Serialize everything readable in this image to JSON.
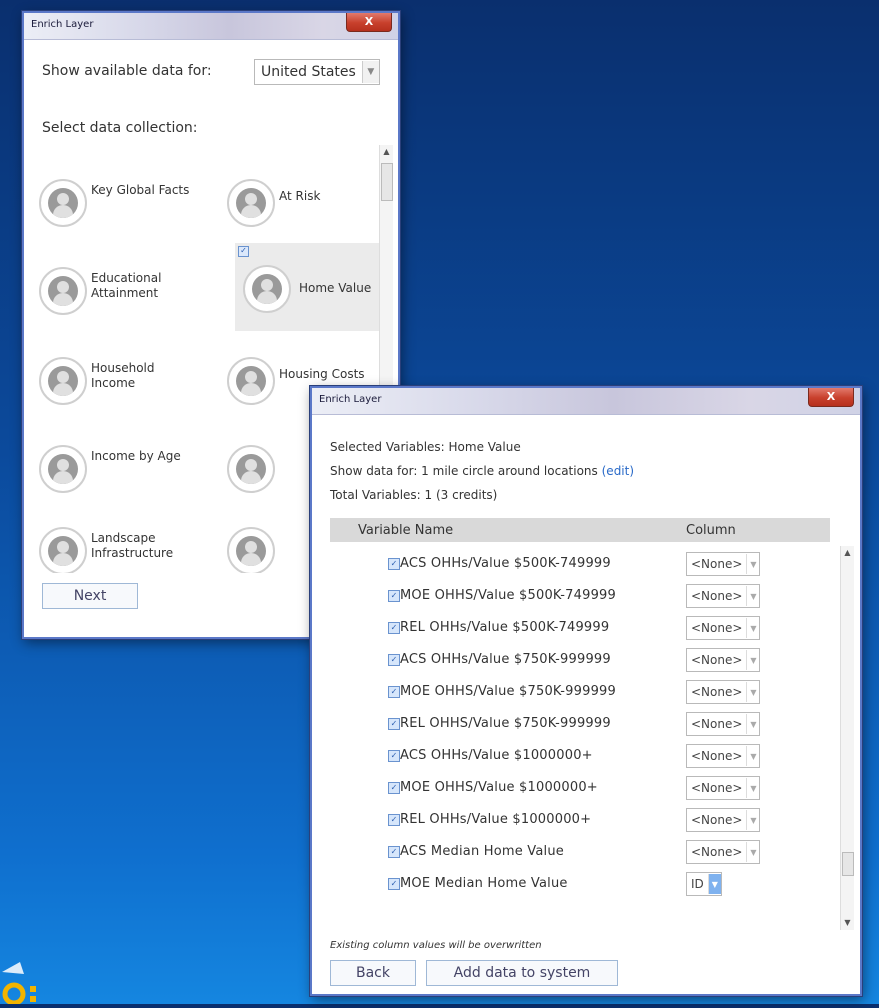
{
  "window1": {
    "title": "Enrich Layer",
    "close_label": "X",
    "show_label": "Show available data for:",
    "country": "United States",
    "select_label": "Select data collection:",
    "collections": [
      {
        "label": "Key Global Facts",
        "selected": false
      },
      {
        "label": "At Risk",
        "selected": false
      },
      {
        "label": "Educational Attainment",
        "selected": false
      },
      {
        "label": "Home Value",
        "selected": true
      },
      {
        "label": "Household Income",
        "selected": false
      },
      {
        "label": "Housing Costs",
        "selected": false
      },
      {
        "label": "Income by Age",
        "selected": false
      },
      {
        "label": "",
        "selected": false
      },
      {
        "label": "Landscape Infrastructure",
        "selected": false
      },
      {
        "label": "",
        "selected": false
      }
    ],
    "next_label": "Next"
  },
  "window2": {
    "title": "Enrich Layer",
    "close_label": "X",
    "selected_variables": "Selected Variables: Home Value",
    "show_data_prefix": "Show data for: 1 mile circle around locations",
    "edit_link": "(edit)",
    "total_variables": "Total Variables: 1 (3 credits)",
    "col_variable_name": "Variable Name",
    "col_column": "Column",
    "rows": [
      {
        "name": "ACS OHHs/Value $500K-749999",
        "column": "<None>"
      },
      {
        "name": "MOE OHHS/Value $500K-749999",
        "column": "<None>"
      },
      {
        "name": "REL OHHs/Value $500K-749999",
        "column": "<None>"
      },
      {
        "name": "ACS OHHs/Value $750K-999999",
        "column": "<None>"
      },
      {
        "name": "MOE OHHS/Value $750K-999999",
        "column": "<None>"
      },
      {
        "name": "REL OHHS/Value $750K-999999",
        "column": "<None>"
      },
      {
        "name": "ACS OHHs/Value $1000000+",
        "column": "<None>"
      },
      {
        "name": "MOE OHHS/Value $1000000+",
        "column": "<None>"
      },
      {
        "name": "REL OHHs/Value $1000000+",
        "column": "<None>"
      },
      {
        "name": "ACS Median Home Value",
        "column": "<None>"
      },
      {
        "name": "MOE Median Home Value",
        "column": "ID"
      }
    ],
    "warning": "Existing column values will be overwritten",
    "back_label": "Back",
    "add_label": "Add data to system"
  }
}
